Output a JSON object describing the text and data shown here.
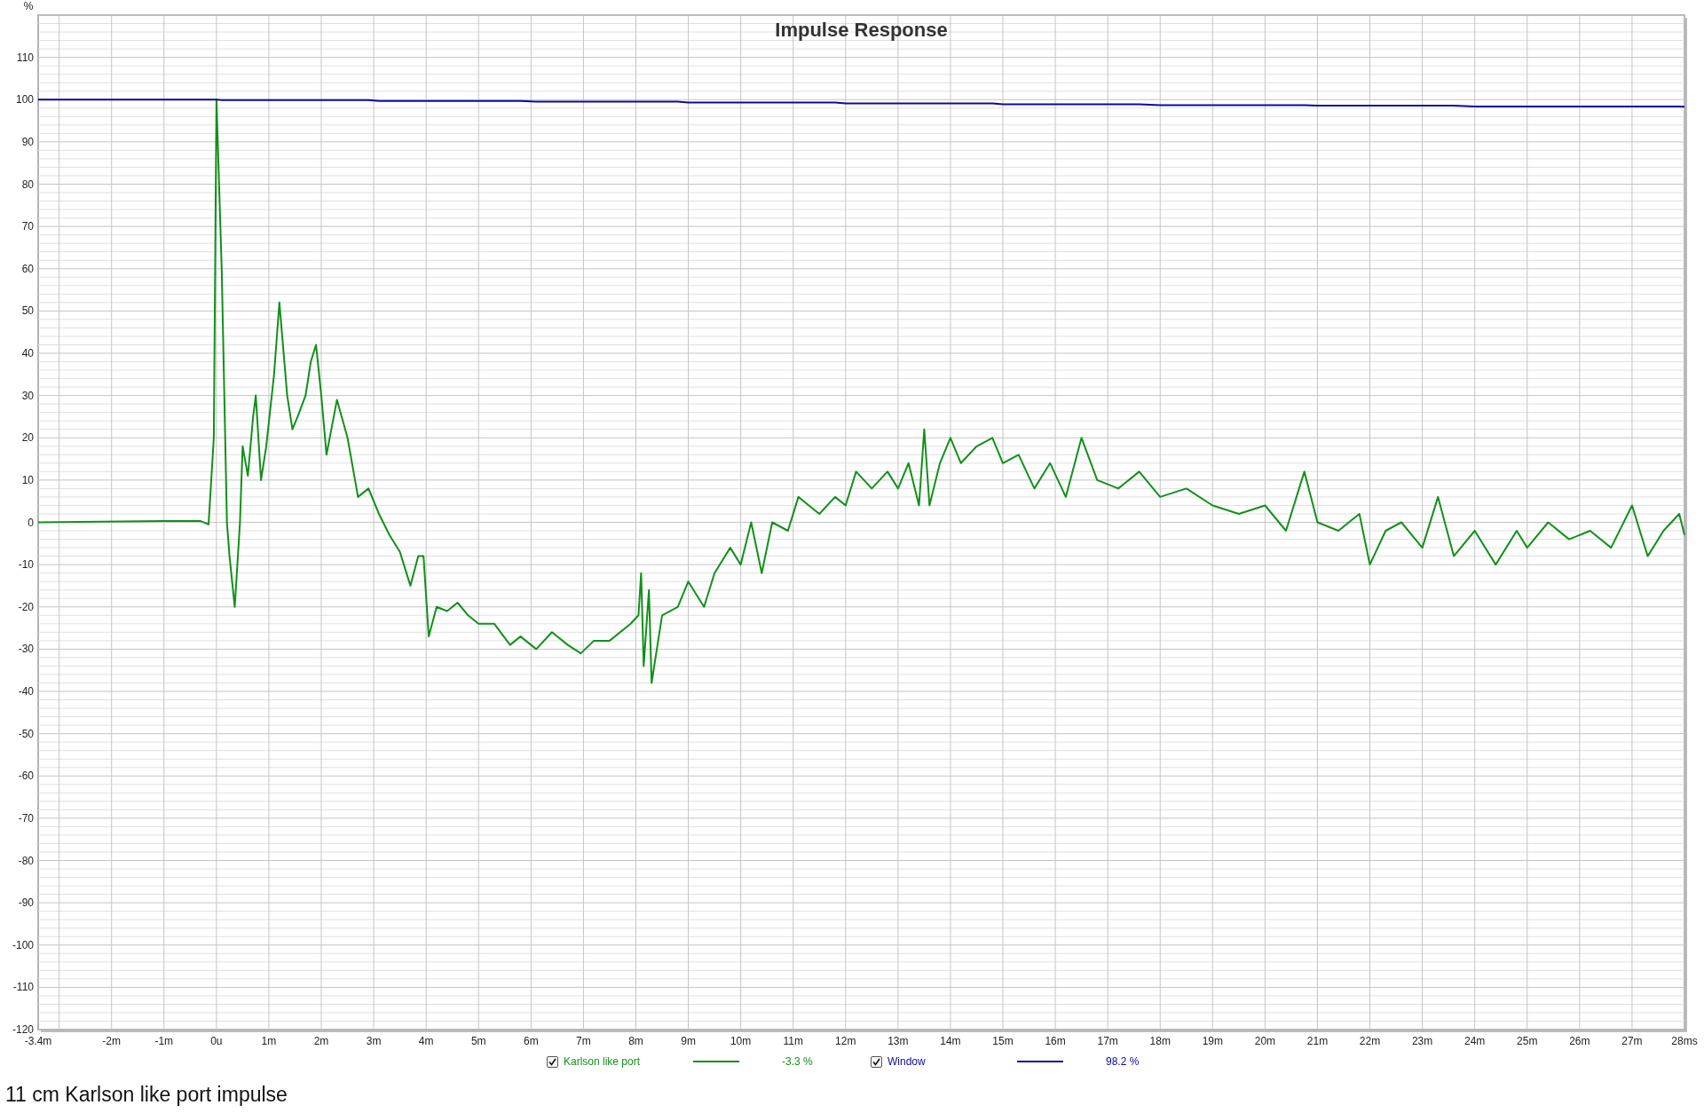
{
  "plot": {
    "chart_data": {
      "type": "line",
      "grid": true,
      "title": "Impulse Response",
      "ylabel": "%",
      "xlim": [
        -3.4,
        28
      ],
      "ylim": [
        -120,
        120
      ],
      "xticks": [
        {
          "value": -3.4,
          "label": "-3.4m"
        },
        {
          "value": -2,
          "label": "-2m"
        },
        {
          "value": -1,
          "label": "-1m"
        },
        {
          "value": 0,
          "label": "0u"
        },
        {
          "value": 1,
          "label": "1m"
        },
        {
          "value": 2,
          "label": "2m"
        },
        {
          "value": 3,
          "label": "3m"
        },
        {
          "value": 4,
          "label": "4m"
        },
        {
          "value": 5,
          "label": "5m"
        },
        {
          "value": 6,
          "label": "6m"
        },
        {
          "value": 7,
          "label": "7m"
        },
        {
          "value": 8,
          "label": "8m"
        },
        {
          "value": 9,
          "label": "9m"
        },
        {
          "value": 10,
          "label": "10m"
        },
        {
          "value": 11,
          "label": "11m"
        },
        {
          "value": 12,
          "label": "12m"
        },
        {
          "value": 13,
          "label": "13m"
        },
        {
          "value": 14,
          "label": "14m"
        },
        {
          "value": 15,
          "label": "15m"
        },
        {
          "value": 16,
          "label": "16m"
        },
        {
          "value": 17,
          "label": "17m"
        },
        {
          "value": 18,
          "label": "18m"
        },
        {
          "value": 19,
          "label": "19m"
        },
        {
          "value": 20,
          "label": "20m"
        },
        {
          "value": 21,
          "label": "21m"
        },
        {
          "value": 22,
          "label": "22m"
        },
        {
          "value": 23,
          "label": "23m"
        },
        {
          "value": 24,
          "label": "24m"
        },
        {
          "value": 25,
          "label": "25m"
        },
        {
          "value": 26,
          "label": "26m"
        },
        {
          "value": 27,
          "label": "27m"
        },
        {
          "value": 28,
          "label": "28ms"
        }
      ],
      "yticks": [
        -120,
        -110,
        -100,
        -90,
        -80,
        -70,
        -60,
        -50,
        -40,
        -30,
        -20,
        -10,
        0,
        10,
        20,
        30,
        40,
        50,
        60,
        70,
        80,
        90,
        100,
        110
      ],
      "x": [
        -3.4,
        -1,
        -0.3,
        -0.15,
        -0.05,
        0,
        0.1,
        0.2,
        0.25,
        0.35,
        0.45,
        0.5,
        0.6,
        0.7,
        0.75,
        0.85,
        0.95,
        1.1,
        1.2,
        1.35,
        1.45,
        1.55,
        1.7,
        1.8,
        1.9,
        2.0,
        2.1,
        2.3,
        2.5,
        2.7,
        2.9,
        3.1,
        3.3,
        3.5,
        3.7,
        3.85,
        3.95,
        4.05,
        4.2,
        4.4,
        4.6,
        4.8,
        5.0,
        5.3,
        5.6,
        5.8,
        6.1,
        6.4,
        6.7,
        6.95,
        7.2,
        7.5,
        7.9,
        8.05,
        8.1,
        8.15,
        8.25,
        8.3,
        8.5,
        8.8,
        9.0,
        9.3,
        9.5,
        9.8,
        10.0,
        10.2,
        10.4,
        10.6,
        10.9,
        11.1,
        11.3,
        11.5,
        11.8,
        12.0,
        12.2,
        12.5,
        12.8,
        13.0,
        13.2,
        13.4,
        13.5,
        13.6,
        13.8,
        14.0,
        14.2,
        14.5,
        14.8,
        15.0,
        15.3,
        15.6,
        15.9,
        16.2,
        16.5,
        16.8,
        17.2,
        17.6,
        18.0,
        18.5,
        19.0,
        19.5,
        20.0,
        20.4,
        20.75,
        21.0,
        21.4,
        21.8,
        22.0,
        22.3,
        22.6,
        23.0,
        23.3,
        23.6,
        24.0,
        24.4,
        24.8,
        25.0,
        25.4,
        25.8,
        26.2,
        26.6,
        27.0,
        27.3,
        27.6,
        27.9,
        28.0
      ],
      "series": [
        {
          "name": "Karlson like port",
          "color": "#12901a",
          "values": [
            0,
            0.3,
            0.3,
            -0.5,
            20,
            100,
            60,
            0,
            -8,
            -20,
            0,
            18,
            11,
            25,
            30,
            10,
            18,
            35,
            52,
            30,
            22,
            25,
            30,
            38,
            42,
            30,
            16,
            29,
            20,
            6,
            8,
            2,
            -3,
            -7,
            -15,
            -8,
            -8,
            -27,
            -20,
            -21,
            -19,
            -22,
            -24,
            -24,
            -29,
            -27,
            -30,
            -26,
            -29,
            -31,
            -28,
            -28,
            -24,
            -22,
            -12,
            -34,
            -16,
            -38,
            -22,
            -20,
            -14,
            -20,
            -12,
            -6,
            -10,
            0,
            -12,
            0,
            -2,
            6,
            4,
            2,
            6,
            4,
            12,
            8,
            12,
            8,
            14,
            4,
            22,
            4,
            14,
            20,
            14,
            18,
            20,
            14,
            16,
            8,
            14,
            6,
            20,
            10,
            8,
            12,
            6,
            8,
            4,
            2,
            4,
            -2,
            12,
            0,
            -2,
            2,
            -10,
            -2,
            0,
            -6,
            6,
            -8,
            -2,
            -10,
            -2,
            -6,
            0,
            -4,
            -2,
            -6,
            4,
            -8,
            -2,
            2,
            -3
          ]
        },
        {
          "name": "Window",
          "color": "#0a0aa0",
          "values": [
            100,
            100,
            100,
            100,
            100,
            100,
            99.9,
            99.9,
            99.9,
            99.9,
            99.9,
            99.9,
            99.9,
            99.9,
            99.9,
            99.9,
            99.9,
            99.9,
            99.9,
            99.9,
            99.9,
            99.9,
            99.9,
            99.9,
            99.9,
            99.9,
            99.9,
            99.9,
            99.9,
            99.9,
            99.9,
            99.7,
            99.7,
            99.7,
            99.7,
            99.7,
            99.7,
            99.7,
            99.7,
            99.7,
            99.7,
            99.7,
            99.7,
            99.7,
            99.7,
            99.7,
            99.5,
            99.5,
            99.5,
            99.5,
            99.5,
            99.5,
            99.5,
            99.5,
            99.5,
            99.5,
            99.5,
            99.5,
            99.5,
            99.5,
            99.3,
            99.3,
            99.3,
            99.3,
            99.3,
            99.3,
            99.3,
            99.3,
            99.3,
            99.3,
            99.3,
            99.3,
            99.3,
            99.1,
            99.1,
            99.1,
            99.1,
            99.1,
            99.1,
            99.1,
            99.1,
            99.1,
            99.1,
            99.1,
            99.1,
            99.1,
            99.1,
            98.9,
            98.9,
            98.9,
            98.9,
            98.9,
            98.9,
            98.9,
            98.9,
            98.9,
            98.7,
            98.7,
            98.7,
            98.7,
            98.7,
            98.7,
            98.7,
            98.6,
            98.6,
            98.6,
            98.6,
            98.6,
            98.6,
            98.6,
            98.6,
            98.6,
            98.4,
            98.4,
            98.4,
            98.4,
            98.4,
            98.4,
            98.4,
            98.4,
            98.4,
            98.4,
            98.4,
            98.4,
            98.3
          ]
        }
      ]
    },
    "legend": [
      {
        "checked": true,
        "reading": "-3.3 %"
      },
      {
        "checked": true,
        "reading": "98.2 %"
      }
    ]
  },
  "caption": "11 cm Karlson like port impulse"
}
